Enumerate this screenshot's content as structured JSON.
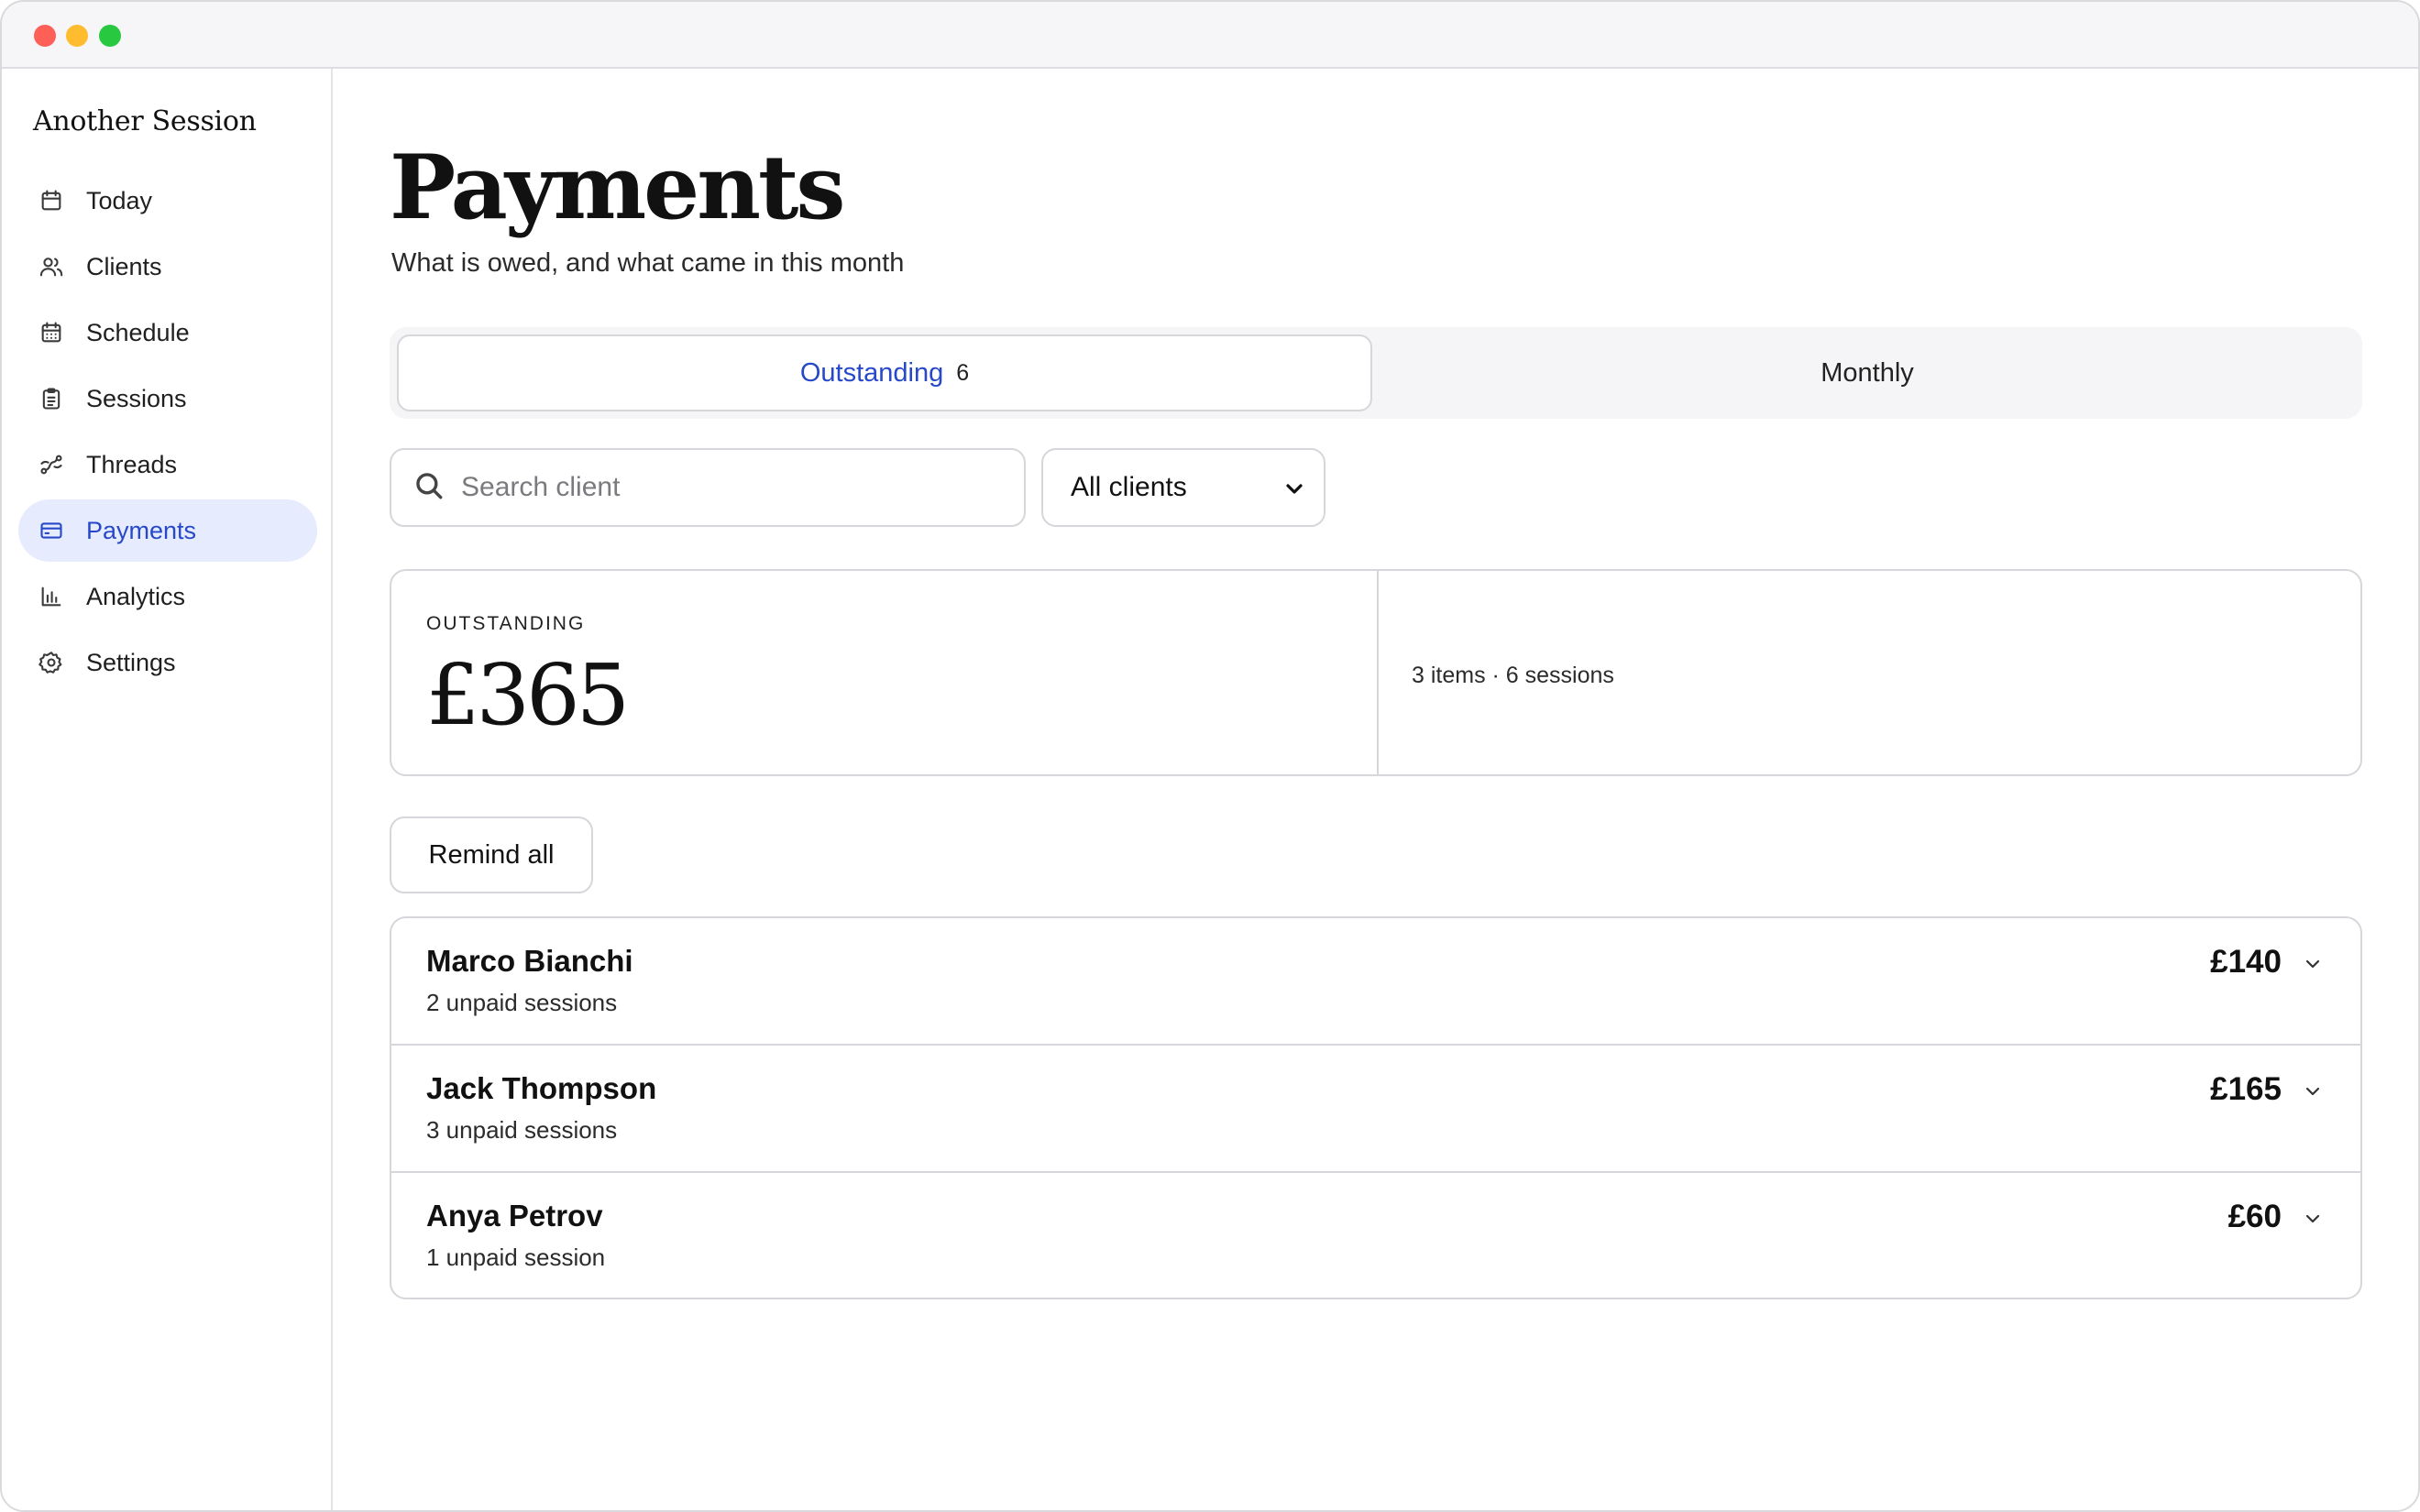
{
  "app": {
    "name": "Another Session"
  },
  "sidebar": {
    "items": [
      {
        "label": "Today",
        "icon": "calendar-icon"
      },
      {
        "label": "Clients",
        "icon": "users-icon"
      },
      {
        "label": "Schedule",
        "icon": "calendar-grid-icon"
      },
      {
        "label": "Sessions",
        "icon": "clipboard-icon"
      },
      {
        "label": "Threads",
        "icon": "threads-icon"
      },
      {
        "label": "Payments",
        "icon": "credit-card-icon",
        "active": true
      },
      {
        "label": "Analytics",
        "icon": "bar-chart-icon"
      },
      {
        "label": "Settings",
        "icon": "gear-icon"
      }
    ]
  },
  "header": {
    "title": "Payments",
    "subtitle": "What is owed, and what came in this month"
  },
  "tabs": [
    {
      "label": "Outstanding",
      "count": "6",
      "active": true
    },
    {
      "label": "Monthly",
      "active": false
    }
  ],
  "search": {
    "placeholder": "Search client",
    "value": ""
  },
  "filter": {
    "selected": "All clients"
  },
  "summary": {
    "label": "OUTSTANDING",
    "amount": "£365",
    "meta": "3 items · 6 sessions"
  },
  "actions": {
    "remind_all": "Remind all"
  },
  "clients": [
    {
      "name": "Marco Bianchi",
      "sub": "2 unpaid sessions",
      "amount": "£140"
    },
    {
      "name": "Jack Thompson",
      "sub": "3 unpaid sessions",
      "amount": "£165"
    },
    {
      "name": "Anya Petrov",
      "sub": "1 unpaid session",
      "amount": "£60"
    }
  ],
  "colors": {
    "accent": "#2749c9",
    "active_nav_bg": "#e6ebfd",
    "border": "#d6d6db"
  }
}
